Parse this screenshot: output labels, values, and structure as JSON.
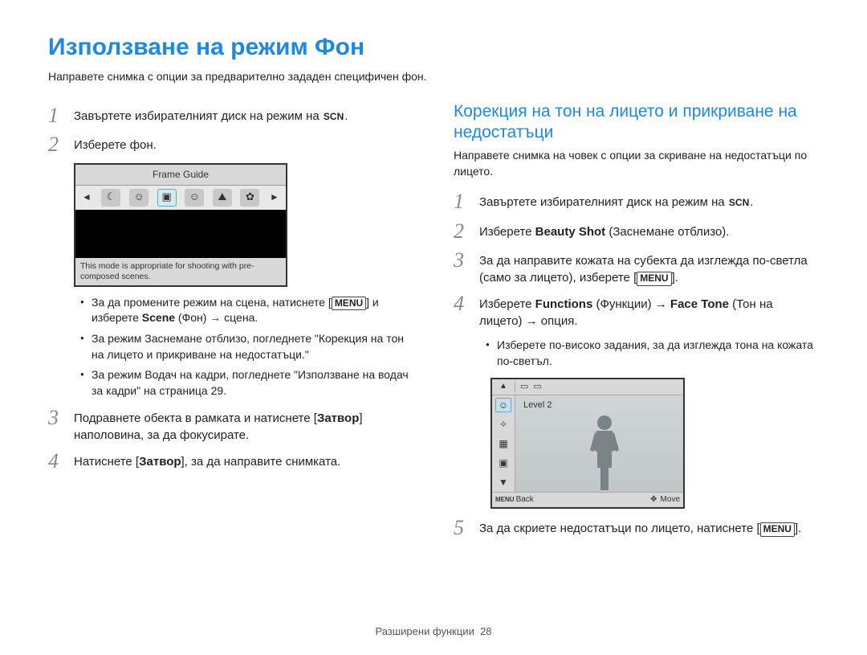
{
  "title": "Използване на режим Фон",
  "intro": "Направете снимка с опции за предварително зададен специфичен фон.",
  "left": {
    "step1_a": "Завъртете избирателният диск на режим на ",
    "step1_b": ".",
    "step2": "Изберете фон.",
    "screen": {
      "title": "Frame Guide",
      "desc": "This mode is appropriate for shooting with pre-composed scenes."
    },
    "bullets": {
      "b1a": "За да промените режим на сцена, натиснете [",
      "b1b": "] и изберете ",
      "b1c": "Scene",
      "b1d": " (Фон) → сцена.",
      "b2": "За режим Заснемане отблизо, погледнете \"Корекция на тон на лицето и прикриване на недостатъци.\"",
      "b3": "За режим Водач на кадри, погледнете \"Използване на водач за кадри\" на страница 29."
    },
    "step3a": "Подравнете обекта в рамката и натиснете [",
    "step3b": "Затвор",
    "step3c": "] наполовина, за да фокусирате.",
    "step4a": "Натиснете [",
    "step4b": "Затвор",
    "step4c": "], за да направите снимката."
  },
  "right": {
    "heading": "Корекция на тон на лицето и прикриване на недостатъци",
    "intro": "Направете снимка на човек с опции за скриване на недостатъци по лицето.",
    "step1_a": "Завъртете избирателният диск на режим на ",
    "step1_b": ".",
    "step2a": "Изберете ",
    "step2b": "Beauty Shot",
    "step2c": " (Заснемане отблизо).",
    "step3a": "За да направите кожата на субекта да изглежда по-светла (само за лицето), изберете [",
    "step3b": "].",
    "step4a": "Изберете ",
    "step4b": "Functions",
    "step4c": " (Функции) → ",
    "step4d": "Face Tone",
    "step4e": " (Тон на лицето) → опция.",
    "bullet": "Изберете по-високо задания, за да изглежда тона на кожата по-светъл.",
    "screen": {
      "level": "Level 2",
      "back": "Back",
      "move": "Move"
    },
    "step5a": "За да скриете недостатъци по лицето, натиснете [",
    "step5b": "]."
  },
  "labels": {
    "scn": "SCN",
    "menu": "MENU",
    "menu_small": "MENU"
  },
  "footer": {
    "section": "Разширени функции",
    "page": "28"
  }
}
